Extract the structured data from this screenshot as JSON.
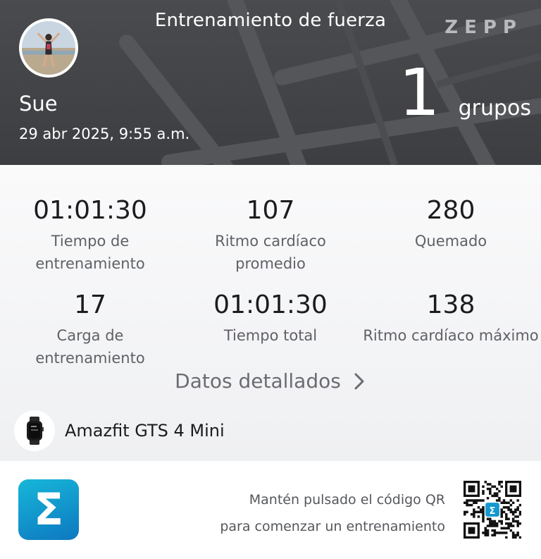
{
  "header": {
    "title": "Entrenamiento de fuerza",
    "brand": "ZEPP",
    "user_name": "Sue",
    "date": "29 abr 2025, 9:55 a.m.",
    "sets_value": "1",
    "sets_unit": "grupos"
  },
  "metrics": [
    {
      "value": "01:01:30",
      "label_line1": "Tiempo de",
      "label_line2": "entrenamiento"
    },
    {
      "value": "107",
      "label_line1": "Ritmo cardíaco",
      "label_line2": "promedio"
    },
    {
      "value": "280",
      "label_line1": "Quemado",
      "label_line2": ""
    },
    {
      "value": "17",
      "label_line1": "Carga de entrenamiento",
      "label_line2": ""
    },
    {
      "value": "01:01:30",
      "label_line1": "Tiempo total",
      "label_line2": ""
    },
    {
      "value": "138",
      "label_line1": "Ritmo cardíaco máximo",
      "label_line2": ""
    }
  ],
  "details_link": "Datos detallados",
  "device": {
    "name": "Amazfit GTS 4 Mini",
    "icon": "watch-icon"
  },
  "footer": {
    "app_logo_glyph": "Σ",
    "qr_text_line1": "Mantén pulsado el código QR",
    "qr_text_line2": "para comenzar un entrenamiento"
  },
  "colors": {
    "header_bg": "#424346",
    "logo_gradient_start": "#17b7d8",
    "logo_gradient_end": "#0d78c0"
  }
}
